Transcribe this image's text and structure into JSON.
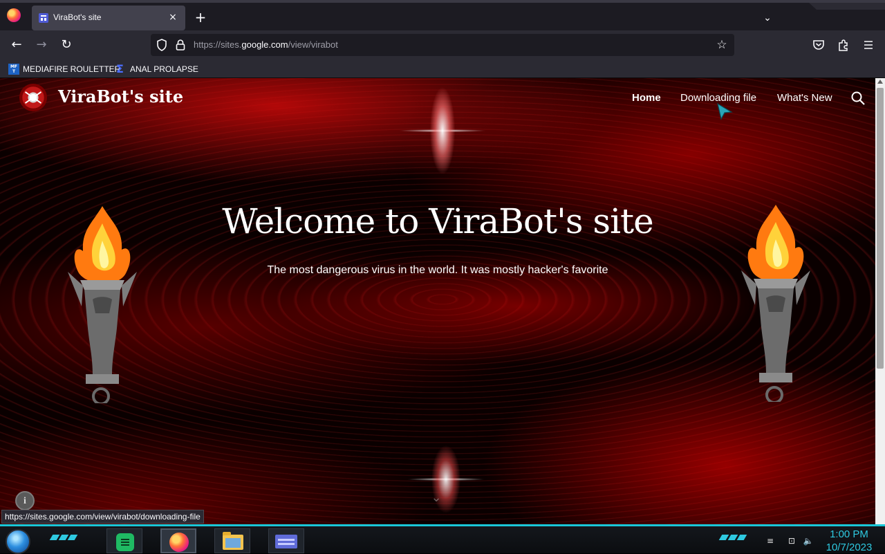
{
  "browser": {
    "tab": {
      "title": "ViraBot's site",
      "close": "×"
    },
    "new_tab": "+",
    "tab_list": "⌄",
    "nav": {
      "back": "←",
      "forward": "→",
      "reload": "↻"
    },
    "url": {
      "prefix": "https://sites.",
      "domain": "google.com",
      "path": "/view/virabot"
    },
    "star": "☆",
    "toolbar_icons": [
      "pocket-icon",
      "extensions-icon",
      "menu-icon"
    ],
    "bookmarks": [
      {
        "label": "MEDIAFIRE ROULETTER",
        "icon": "MF T"
      },
      {
        "label": "ANAL PROLAPSE",
        "icon": "Σ"
      }
    ],
    "status_url": "https://sites.google.com/view/virabot/downloading-file"
  },
  "site": {
    "title": "ViraBot's site",
    "nav": [
      {
        "label": "Home",
        "active": true
      },
      {
        "label": "Downloading file",
        "active": false
      },
      {
        "label": "What's New",
        "active": false
      }
    ],
    "hero": {
      "title": "Welcome to ViraBot's site",
      "subtitle": "The most dangerous virus in the world. It was mostly hacker's favorite"
    },
    "info": "i",
    "chevron": "⌄"
  },
  "taskbar": {
    "apps": [
      "sheets-icon",
      "firefox-icon",
      "file-explorer-icon",
      "card-app-icon"
    ],
    "time": "1:00 PM",
    "date": "10/7/2023",
    "tray": {
      "keyboard": "≡",
      "network": "⊡",
      "volume": "🔈"
    }
  },
  "colors": {
    "accent_teal": "#19c7d8",
    "page_red": "#c00000",
    "chrome_dark": "#1c1b22"
  }
}
